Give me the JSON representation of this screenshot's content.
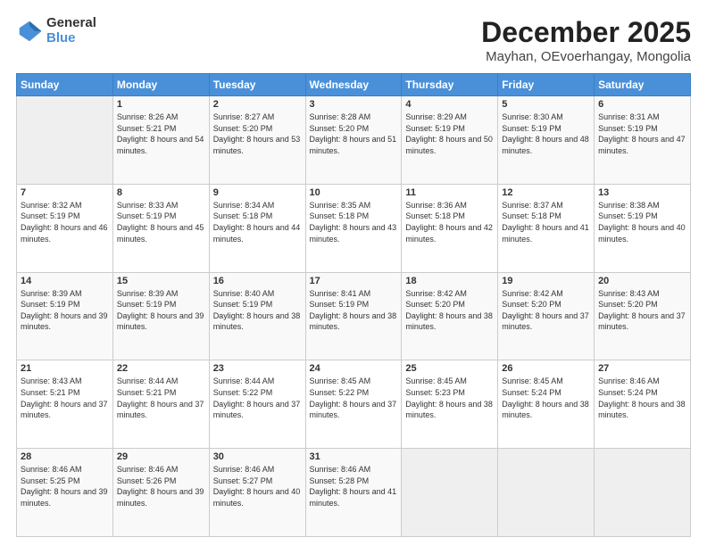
{
  "logo": {
    "general": "General",
    "blue": "Blue"
  },
  "title": "December 2025",
  "subtitle": "Mayhan, OEvoerhangay, Mongolia",
  "header_days": [
    "Sunday",
    "Monday",
    "Tuesday",
    "Wednesday",
    "Thursday",
    "Friday",
    "Saturday"
  ],
  "weeks": [
    [
      {
        "day": "",
        "empty": true
      },
      {
        "day": "1",
        "sunrise": "8:26 AM",
        "sunset": "5:21 PM",
        "daylight": "8 hours and 54 minutes."
      },
      {
        "day": "2",
        "sunrise": "8:27 AM",
        "sunset": "5:20 PM",
        "daylight": "8 hours and 53 minutes."
      },
      {
        "day": "3",
        "sunrise": "8:28 AM",
        "sunset": "5:20 PM",
        "daylight": "8 hours and 51 minutes."
      },
      {
        "day": "4",
        "sunrise": "8:29 AM",
        "sunset": "5:19 PM",
        "daylight": "8 hours and 50 minutes."
      },
      {
        "day": "5",
        "sunrise": "8:30 AM",
        "sunset": "5:19 PM",
        "daylight": "8 hours and 48 minutes."
      },
      {
        "day": "6",
        "sunrise": "8:31 AM",
        "sunset": "5:19 PM",
        "daylight": "8 hours and 47 minutes."
      }
    ],
    [
      {
        "day": "7",
        "sunrise": "8:32 AM",
        "sunset": "5:19 PM",
        "daylight": "8 hours and 46 minutes."
      },
      {
        "day": "8",
        "sunrise": "8:33 AM",
        "sunset": "5:19 PM",
        "daylight": "8 hours and 45 minutes."
      },
      {
        "day": "9",
        "sunrise": "8:34 AM",
        "sunset": "5:18 PM",
        "daylight": "8 hours and 44 minutes."
      },
      {
        "day": "10",
        "sunrise": "8:35 AM",
        "sunset": "5:18 PM",
        "daylight": "8 hours and 43 minutes."
      },
      {
        "day": "11",
        "sunrise": "8:36 AM",
        "sunset": "5:18 PM",
        "daylight": "8 hours and 42 minutes."
      },
      {
        "day": "12",
        "sunrise": "8:37 AM",
        "sunset": "5:18 PM",
        "daylight": "8 hours and 41 minutes."
      },
      {
        "day": "13",
        "sunrise": "8:38 AM",
        "sunset": "5:19 PM",
        "daylight": "8 hours and 40 minutes."
      }
    ],
    [
      {
        "day": "14",
        "sunrise": "8:39 AM",
        "sunset": "5:19 PM",
        "daylight": "8 hours and 39 minutes."
      },
      {
        "day": "15",
        "sunrise": "8:39 AM",
        "sunset": "5:19 PM",
        "daylight": "8 hours and 39 minutes."
      },
      {
        "day": "16",
        "sunrise": "8:40 AM",
        "sunset": "5:19 PM",
        "daylight": "8 hours and 38 minutes."
      },
      {
        "day": "17",
        "sunrise": "8:41 AM",
        "sunset": "5:19 PM",
        "daylight": "8 hours and 38 minutes."
      },
      {
        "day": "18",
        "sunrise": "8:42 AM",
        "sunset": "5:20 PM",
        "daylight": "8 hours and 38 minutes."
      },
      {
        "day": "19",
        "sunrise": "8:42 AM",
        "sunset": "5:20 PM",
        "daylight": "8 hours and 37 minutes."
      },
      {
        "day": "20",
        "sunrise": "8:43 AM",
        "sunset": "5:20 PM",
        "daylight": "8 hours and 37 minutes."
      }
    ],
    [
      {
        "day": "21",
        "sunrise": "8:43 AM",
        "sunset": "5:21 PM",
        "daylight": "8 hours and 37 minutes."
      },
      {
        "day": "22",
        "sunrise": "8:44 AM",
        "sunset": "5:21 PM",
        "daylight": "8 hours and 37 minutes."
      },
      {
        "day": "23",
        "sunrise": "8:44 AM",
        "sunset": "5:22 PM",
        "daylight": "8 hours and 37 minutes."
      },
      {
        "day": "24",
        "sunrise": "8:45 AM",
        "sunset": "5:22 PM",
        "daylight": "8 hours and 37 minutes."
      },
      {
        "day": "25",
        "sunrise": "8:45 AM",
        "sunset": "5:23 PM",
        "daylight": "8 hours and 38 minutes."
      },
      {
        "day": "26",
        "sunrise": "8:45 AM",
        "sunset": "5:24 PM",
        "daylight": "8 hours and 38 minutes."
      },
      {
        "day": "27",
        "sunrise": "8:46 AM",
        "sunset": "5:24 PM",
        "daylight": "8 hours and 38 minutes."
      }
    ],
    [
      {
        "day": "28",
        "sunrise": "8:46 AM",
        "sunset": "5:25 PM",
        "daylight": "8 hours and 39 minutes."
      },
      {
        "day": "29",
        "sunrise": "8:46 AM",
        "sunset": "5:26 PM",
        "daylight": "8 hours and 39 minutes."
      },
      {
        "day": "30",
        "sunrise": "8:46 AM",
        "sunset": "5:27 PM",
        "daylight": "8 hours and 40 minutes."
      },
      {
        "day": "31",
        "sunrise": "8:46 AM",
        "sunset": "5:28 PM",
        "daylight": "8 hours and 41 minutes."
      },
      {
        "day": "",
        "empty": true
      },
      {
        "day": "",
        "empty": true
      },
      {
        "day": "",
        "empty": true
      }
    ]
  ]
}
